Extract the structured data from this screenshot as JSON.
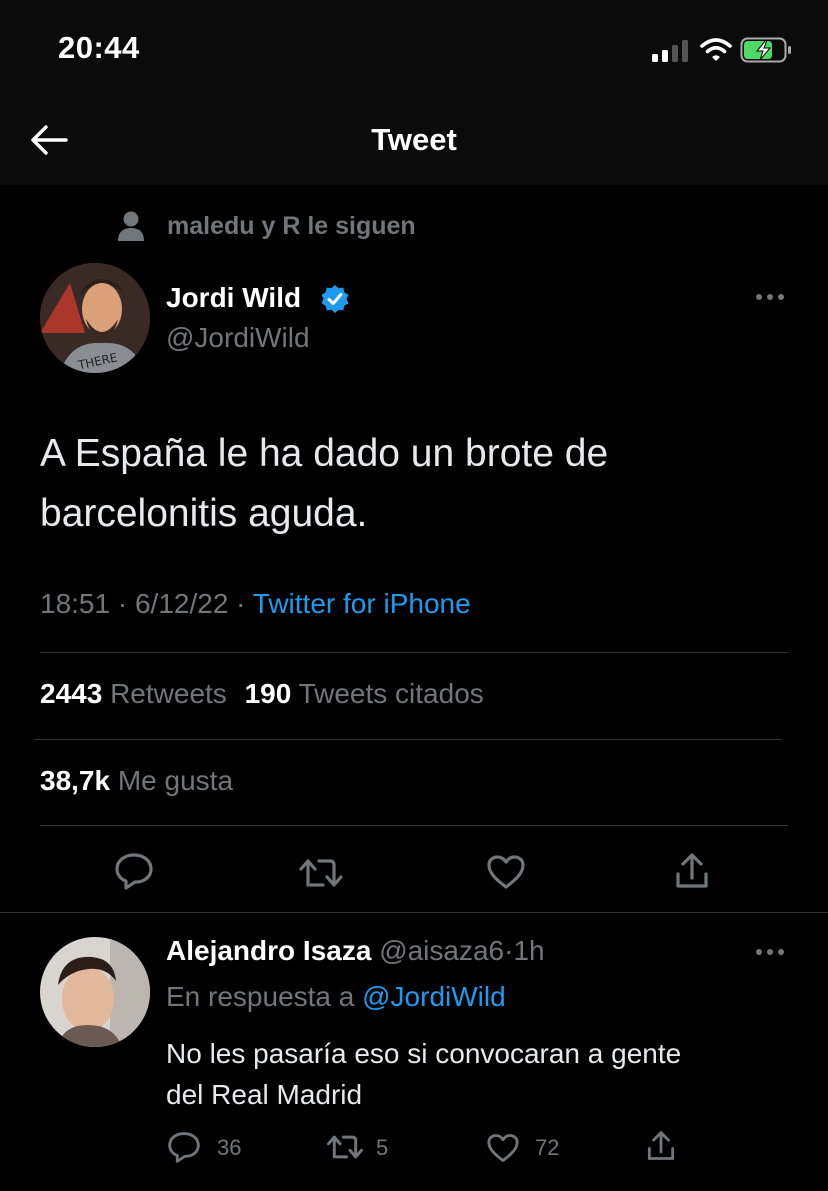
{
  "status_bar": {
    "time": "20:44"
  },
  "header": {
    "title": "Tweet"
  },
  "social_context": {
    "text": "maledu y R le siguen"
  },
  "tweet": {
    "author_name": "Jordi Wild",
    "author_handle": "@JordiWild",
    "text_line1": "A España le ha dado un brote de",
    "text_line2": "barcelonitis aguda.",
    "time": "18:51",
    "dot1": "·",
    "date": "6/12/22",
    "dot2": "·",
    "source": "Twitter for iPhone",
    "retweets_count": "2443",
    "retweets_label": "Retweets",
    "quotes_count": "190",
    "quotes_label": "Tweets citados",
    "likes_count": "38,7k",
    "likes_label": "Me gusta"
  },
  "reply": {
    "author_name": "Alejandro Isaza",
    "author_handle": "@aisaza6",
    "dot": "·",
    "age": "1h",
    "replying_prefix": "En respuesta a",
    "replying_to": "@JordiWild",
    "text_line1": "No les pasaría eso si convocaran a gente",
    "text_line2": "del Real Madrid",
    "reply_count": "36",
    "retweet_count": "5",
    "like_count": "72"
  },
  "colors": {
    "background": "#000000",
    "accent": "#1d9bf0",
    "muted": "#71767b",
    "text": "#e7e9ea"
  }
}
